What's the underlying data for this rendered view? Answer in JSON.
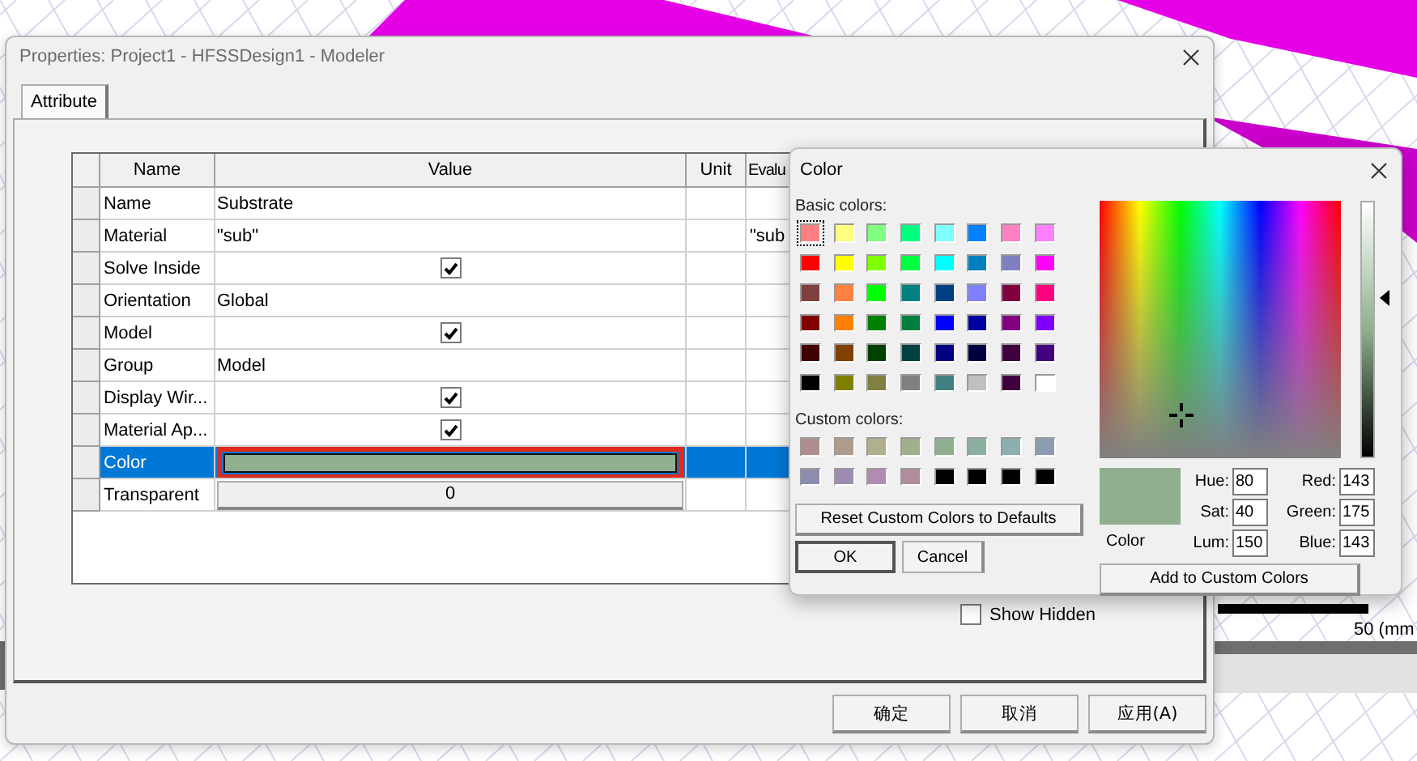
{
  "properties_dialog": {
    "title": "Properties: Project1 - HFSSDesign1 - Modeler",
    "tabs": [
      {
        "label": "Attribute",
        "selected": true
      }
    ],
    "table": {
      "columns": [
        "Name",
        "Value",
        "Unit",
        "Evalu"
      ],
      "rows": [
        {
          "name": "Name",
          "kind": "text",
          "value": "Substrate",
          "selected": false
        },
        {
          "name": "Material",
          "kind": "text",
          "value": "\"sub\"",
          "evaluated": "\"sub",
          "selected": false
        },
        {
          "name": "Solve Inside",
          "kind": "checkbox",
          "checked": true,
          "selected": false
        },
        {
          "name": "Orientation",
          "kind": "text",
          "value": "Global",
          "selected": false
        },
        {
          "name": "Model",
          "kind": "checkbox",
          "checked": true,
          "selected": false
        },
        {
          "name": "Group",
          "kind": "text",
          "value": "Model",
          "selected": false
        },
        {
          "name": "Display Wir...",
          "kind": "checkbox",
          "checked": true,
          "selected": false
        },
        {
          "name": "Material Ap...",
          "kind": "checkbox",
          "checked": true,
          "selected": false
        },
        {
          "name": "Color",
          "kind": "color",
          "color": "#8faf8f",
          "selected": true
        },
        {
          "name": "Transparent",
          "kind": "button",
          "value": "0",
          "selected": false
        }
      ]
    },
    "show_hidden": {
      "label": "Show Hidden",
      "checked": false
    },
    "buttons": [
      "确定",
      "取消",
      "应用(A)"
    ]
  },
  "color_dialog": {
    "title": "Color",
    "basic_colors_label": "Basic colors:",
    "basic_colors": [
      {
        "color": "#ff8080",
        "selected": true
      },
      {
        "color": "#ffff80",
        "selected": false
      },
      {
        "color": "#80ff80",
        "selected": false
      },
      {
        "color": "#00ff80",
        "selected": false
      },
      {
        "color": "#80ffff",
        "selected": false
      },
      {
        "color": "#0080ff",
        "selected": false
      },
      {
        "color": "#ff80c0",
        "selected": false
      },
      {
        "color": "#ff80ff",
        "selected": false
      },
      {
        "color": "#ff0000",
        "selected": false
      },
      {
        "color": "#ffff00",
        "selected": false
      },
      {
        "color": "#80ff00",
        "selected": false
      },
      {
        "color": "#00ff40",
        "selected": false
      },
      {
        "color": "#00ffff",
        "selected": false
      },
      {
        "color": "#0080c0",
        "selected": false
      },
      {
        "color": "#8080c0",
        "selected": false
      },
      {
        "color": "#ff00ff",
        "selected": false
      },
      {
        "color": "#804040",
        "selected": false
      },
      {
        "color": "#ff8040",
        "selected": false
      },
      {
        "color": "#00ff00",
        "selected": false
      },
      {
        "color": "#008080",
        "selected": false
      },
      {
        "color": "#004080",
        "selected": false
      },
      {
        "color": "#8080ff",
        "selected": false
      },
      {
        "color": "#800040",
        "selected": false
      },
      {
        "color": "#ff0080",
        "selected": false
      },
      {
        "color": "#800000",
        "selected": false
      },
      {
        "color": "#ff8000",
        "selected": false
      },
      {
        "color": "#008000",
        "selected": false
      },
      {
        "color": "#008040",
        "selected": false
      },
      {
        "color": "#0000ff",
        "selected": false
      },
      {
        "color": "#0000a0",
        "selected": false
      },
      {
        "color": "#800080",
        "selected": false
      },
      {
        "color": "#8000ff",
        "selected": false
      },
      {
        "color": "#400000",
        "selected": false
      },
      {
        "color": "#804000",
        "selected": false
      },
      {
        "color": "#004000",
        "selected": false
      },
      {
        "color": "#004040",
        "selected": false
      },
      {
        "color": "#000080",
        "selected": false
      },
      {
        "color": "#000040",
        "selected": false
      },
      {
        "color": "#400040",
        "selected": false
      },
      {
        "color": "#400080",
        "selected": false
      },
      {
        "color": "#000000",
        "selected": false
      },
      {
        "color": "#808000",
        "selected": false
      },
      {
        "color": "#808040",
        "selected": false
      },
      {
        "color": "#808080",
        "selected": false
      },
      {
        "color": "#408080",
        "selected": false
      },
      {
        "color": "#c0c0c0",
        "selected": false
      },
      {
        "color": "#400040",
        "selected": false
      },
      {
        "color": "#ffffff",
        "selected": false
      }
    ],
    "custom_colors_label": "Custom colors:",
    "custom_colors": [
      {
        "color": "#b08c8c"
      },
      {
        "color": "#b09c8c"
      },
      {
        "color": "#b0b08c"
      },
      {
        "color": "#a0b08c"
      },
      {
        "color": "#8faf8f"
      },
      {
        "color": "#8cb0a0"
      },
      {
        "color": "#8cb0b0"
      },
      {
        "color": "#8c9cb0"
      },
      {
        "color": "#8c8cb0"
      },
      {
        "color": "#9c8cb0"
      },
      {
        "color": "#b08cb0"
      },
      {
        "color": "#b08c9c"
      },
      {
        "color": "#000000"
      },
      {
        "color": "#000000"
      },
      {
        "color": "#000000"
      },
      {
        "color": "#000000"
      }
    ],
    "reset_button": "Reset Custom Colors to Defaults",
    "ok_button": "OK",
    "cancel_button": "Cancel",
    "preview": {
      "color": "#8faf8f",
      "label": "Color"
    },
    "fields": [
      {
        "label": "Hue:",
        "value": "80"
      },
      {
        "label": "Red:",
        "value": "143"
      },
      {
        "label": "Sat:",
        "value": "40"
      },
      {
        "label": "Green:",
        "value": "175"
      },
      {
        "label": "Lum:",
        "value": "150"
      },
      {
        "label": "Blue:",
        "value": "143"
      }
    ],
    "add_button": "Add to Custom Colors"
  },
  "scale_bar": {
    "label": "50 (mm"
  }
}
